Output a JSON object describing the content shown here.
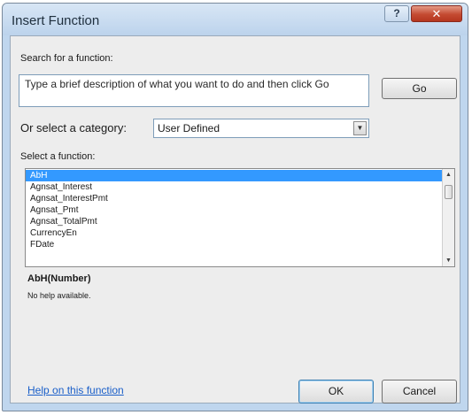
{
  "window": {
    "title": "Insert Function",
    "help_glyph": "?",
    "close_glyph": "✕"
  },
  "search": {
    "label": "Search for a function:",
    "value": "Type a brief description of what you want to do and then click Go",
    "go_label": "Go"
  },
  "category": {
    "label": "Or select a category:",
    "selected": "User Defined",
    "arrow_glyph": "▼"
  },
  "functions": {
    "label": "Select a function:",
    "items": [
      "AbH",
      "Agnsat_Interest",
      "Agnsat_InterestPmt",
      "Agnsat_Pmt",
      "Agnsat_TotalPmt",
      "CurrencyEn",
      "FDate"
    ],
    "selected_index": 0,
    "scroll_up_glyph": "▲",
    "scroll_down_glyph": "▼"
  },
  "details": {
    "syntax": "AbH(Number)",
    "description": "No help available."
  },
  "footer": {
    "help_link": "Help on this function",
    "ok_label": "OK",
    "cancel_label": "Cancel"
  },
  "colors": {
    "selection": "#3399ff",
    "link": "#1a5fc9",
    "close_button": "#c44a31"
  }
}
